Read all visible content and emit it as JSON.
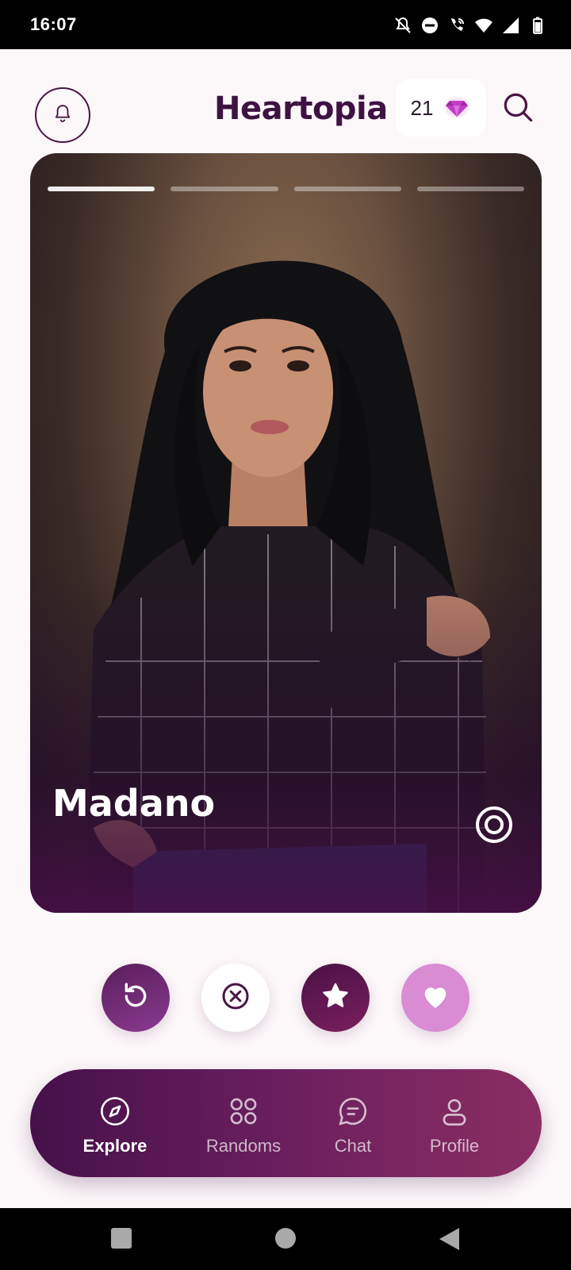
{
  "status_bar": {
    "time": "16:07",
    "icons": [
      "mute-bell-icon",
      "do-not-disturb-icon",
      "wifi-call-icon",
      "wifi-icon",
      "cell-signal-icon",
      "battery-icon"
    ]
  },
  "header": {
    "brand": "Heartopia",
    "gem_count": "21",
    "icons": {
      "left": "bell-icon",
      "gem": "gem-icon",
      "right": "search-icon"
    }
  },
  "card": {
    "name": "Madano",
    "photo_count": 4,
    "active_photo_index": 0
  },
  "actions": [
    {
      "name": "rewind",
      "icon": "rewind-icon"
    },
    {
      "name": "nope",
      "icon": "close-circle-icon"
    },
    {
      "name": "super-like",
      "icon": "star-icon"
    },
    {
      "name": "like",
      "icon": "heart-icon"
    }
  ],
  "nav": {
    "items": [
      {
        "label": "Explore",
        "icon": "compass-icon",
        "active": true
      },
      {
        "label": "Randoms",
        "icon": "grid-icon",
        "active": false
      },
      {
        "label": "Chat",
        "icon": "chat-bubble-icon",
        "active": false
      },
      {
        "label": "Profile",
        "icon": "person-icon",
        "active": false
      }
    ]
  },
  "colors": {
    "brand": "#3e1242",
    "accent_pink": "#d98bd4",
    "nav_gradient_start": "#45114a",
    "nav_gradient_end": "#8a2e63",
    "background": "#fcf7f9"
  }
}
